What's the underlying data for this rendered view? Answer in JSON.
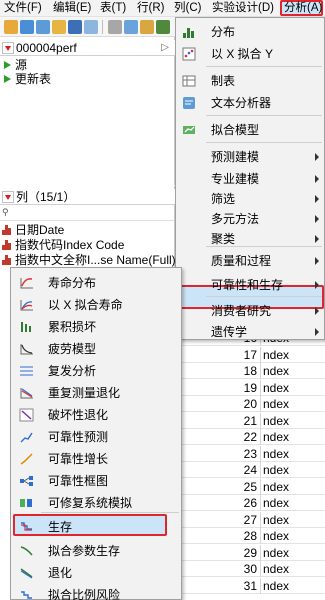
{
  "menubar": {
    "items": [
      "文件(F)",
      "编辑(E)",
      "表(T)",
      "行(R)",
      "列(C)",
      "实验设计(D)",
      "分析(A)"
    ]
  },
  "table_panel": {
    "title": "000004perf",
    "items": [
      "源",
      "更新表"
    ]
  },
  "columns_panel": {
    "title": "列（15/1）",
    "columns": [
      "日期Date",
      "指数代码Index Code",
      "指数中文全称I...se Name(Full)"
    ]
  },
  "grid": {
    "rows": [
      {
        "num": "16",
        "text": "ndex"
      },
      {
        "num": "17",
        "text": "ndex"
      },
      {
        "num": "18",
        "text": "ndex"
      },
      {
        "num": "19",
        "text": "ndex"
      },
      {
        "num": "20",
        "text": "ndex"
      },
      {
        "num": "21",
        "text": "ndex"
      },
      {
        "num": "22",
        "text": "ndex"
      },
      {
        "num": "23",
        "text": "ndex"
      },
      {
        "num": "24",
        "text": "ndex"
      },
      {
        "num": "25",
        "text": "ndex"
      },
      {
        "num": "26",
        "text": "ndex"
      },
      {
        "num": "27",
        "text": "ndex"
      },
      {
        "num": "28",
        "text": "ndex"
      },
      {
        "num": "29",
        "text": "ndex"
      },
      {
        "num": "30",
        "text": "ndex"
      },
      {
        "num": "31",
        "text": "ndex"
      }
    ]
  },
  "analyze_menu": {
    "items": [
      {
        "label": "分布",
        "icon": "distribution-icon"
      },
      {
        "label": "以 X 拟合 Y",
        "icon": "fit-y-by-x-icon"
      },
      {
        "label": "制表",
        "icon": "tabulate-icon"
      },
      {
        "label": "文本分析器",
        "icon": "text-explorer-icon"
      },
      {
        "label": "拟合模型",
        "icon": "fit-model-icon"
      },
      {
        "label": "预测建模"
      },
      {
        "label": "专业建模"
      },
      {
        "label": "筛选"
      },
      {
        "label": "多元方法"
      },
      {
        "label": "聚类"
      },
      {
        "label": "质量和过程"
      },
      {
        "label": "可靠性和生存"
      },
      {
        "label": "消费者研究"
      },
      {
        "label": "遗传学"
      }
    ]
  },
  "reliability_submenu": {
    "items": [
      {
        "label": "寿命分布",
        "icon": "life-distribution-icon"
      },
      {
        "label": "以 X 拟合寿命",
        "icon": "fit-life-by-x-icon"
      },
      {
        "label": "累积损坏",
        "icon": "cumulative-damage-icon"
      },
      {
        "label": "疲劳模型",
        "icon": "fatigue-model-icon"
      },
      {
        "label": "复发分析",
        "icon": "recurrence-analysis-icon"
      },
      {
        "label": "重复测量退化",
        "icon": "repeated-measures-degradation-icon"
      },
      {
        "label": "破坏性退化",
        "icon": "destructive-degradation-icon"
      },
      {
        "label": "可靠性预测",
        "icon": "reliability-forecast-icon"
      },
      {
        "label": "可靠性增长",
        "icon": "reliability-growth-icon"
      },
      {
        "label": "可靠性框图",
        "icon": "reliability-block-diagram-icon"
      },
      {
        "label": "可修复系统模拟",
        "icon": "repairable-systems-simulation-icon"
      },
      {
        "label": "生存",
        "icon": "survival-icon"
      },
      {
        "label": "拟合参数生存",
        "icon": "fit-parametric-survival-icon"
      },
      {
        "label": "退化",
        "icon": "degradation-icon"
      },
      {
        "label": "拟合比例风险",
        "icon": "fit-proportional-hazards-icon"
      }
    ]
  },
  "colors": {
    "highlight": "#cce4f7",
    "highlight_border": "#e0262d",
    "menu_bg": "#f2f2f2"
  }
}
